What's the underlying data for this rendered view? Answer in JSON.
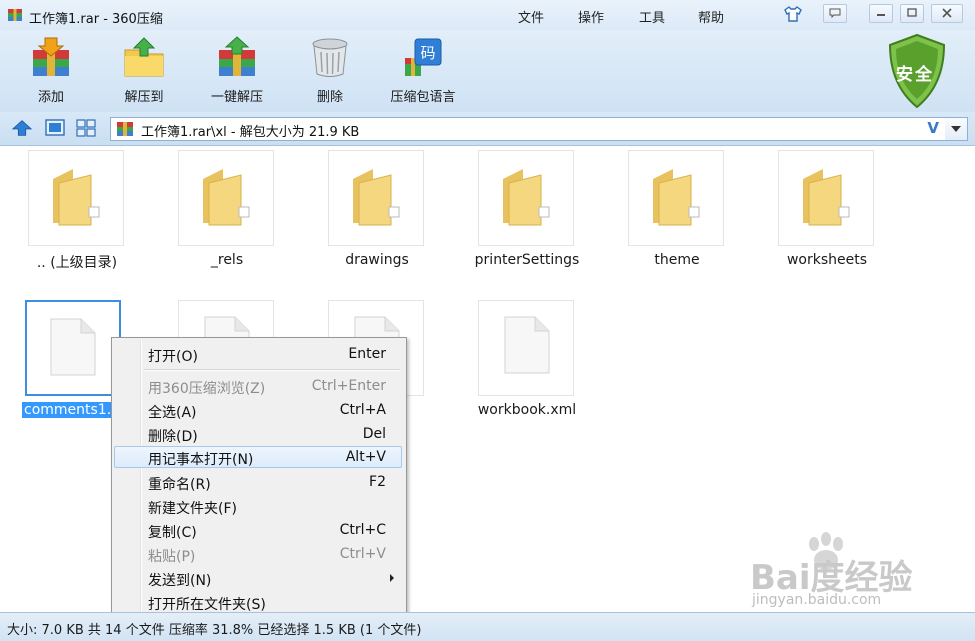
{
  "window": {
    "title": "工作簿1.rar - 360压缩",
    "menu": [
      "文件",
      "操作",
      "工具",
      "帮助"
    ]
  },
  "toolbar": {
    "buttons": [
      "添加",
      "解压到",
      "一键解压",
      "删除",
      "压缩包语言"
    ],
    "shield_label": "安全"
  },
  "address": {
    "path": "工作簿1.rar\\xl - 解包大小为 21.9 KB",
    "v_label": "V"
  },
  "items": [
    {
      "name": ".. (上级目录)",
      "type": "folder"
    },
    {
      "name": "_rels",
      "type": "folder"
    },
    {
      "name": "drawings",
      "type": "folder"
    },
    {
      "name": "printerSettings",
      "type": "folder"
    },
    {
      "name": "theme",
      "type": "folder"
    },
    {
      "name": "worksheets",
      "type": "folder"
    },
    {
      "name": "comments1.x",
      "type": "file"
    },
    {
      "name": "",
      "type": "file"
    },
    {
      "name": "",
      "type": "file"
    },
    {
      "name": "workbook.xml",
      "type": "file"
    }
  ],
  "context_menu": {
    "items": [
      {
        "label": "打开(O)",
        "shortcut": "Enter"
      },
      {
        "label": "用360压缩浏览(Z)",
        "shortcut": "Ctrl+Enter"
      },
      {
        "label": "全选(A)",
        "shortcut": "Ctrl+A"
      },
      {
        "label": "删除(D)",
        "shortcut": "Del"
      },
      {
        "label": "用记事本打开(N)",
        "shortcut": "Alt+V"
      },
      {
        "label": "重命名(R)",
        "shortcut": "F2"
      },
      {
        "label": "新建文件夹(F)",
        "shortcut": ""
      },
      {
        "label": "复制(C)",
        "shortcut": "Ctrl+C"
      },
      {
        "label": "粘贴(P)",
        "shortcut": "Ctrl+V"
      },
      {
        "label": "发送到(N)",
        "shortcut": ""
      },
      {
        "label": "打开所在文件夹(S)",
        "shortcut": ""
      }
    ]
  },
  "status": {
    "text": "大小: 7.0 KB 共 14 个文件 压缩率 31.8% 已经选择 1.5 KB (1 个文件)"
  },
  "watermark": {
    "logo": "Bai度经验",
    "url": "jingyan.baidu.com"
  },
  "colors": {
    "selection": "#3399ff",
    "shield": "#5aa02c"
  }
}
